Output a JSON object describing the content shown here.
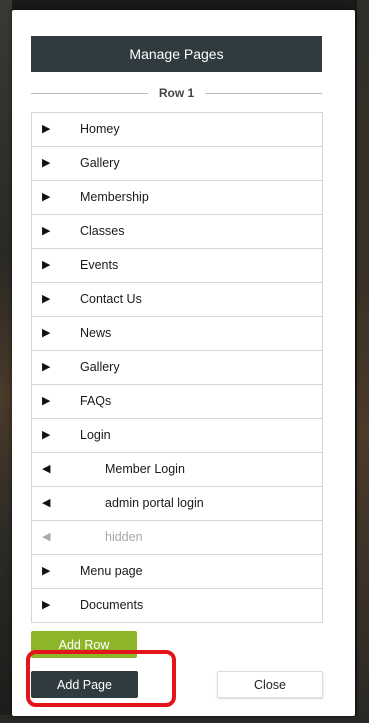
{
  "modal": {
    "title": "Manage Pages",
    "row_label": "Row 1",
    "pages": [
      {
        "label": "Homey",
        "arrow": "▶",
        "level": "top",
        "state": "normal"
      },
      {
        "label": "Gallery",
        "arrow": "▶",
        "level": "top",
        "state": "normal"
      },
      {
        "label": "Membership",
        "arrow": "▶",
        "level": "top",
        "state": "normal"
      },
      {
        "label": "Classes",
        "arrow": "▶",
        "level": "top",
        "state": "normal"
      },
      {
        "label": "Events",
        "arrow": "▶",
        "level": "top",
        "state": "normal"
      },
      {
        "label": "Contact Us",
        "arrow": "▶",
        "level": "top",
        "state": "normal"
      },
      {
        "label": "News",
        "arrow": "▶",
        "level": "top",
        "state": "normal"
      },
      {
        "label": "Gallery",
        "arrow": "▶",
        "level": "top",
        "state": "normal"
      },
      {
        "label": "FAQs",
        "arrow": "▶",
        "level": "top",
        "state": "normal"
      },
      {
        "label": "Login",
        "arrow": "▶",
        "level": "top",
        "state": "normal"
      },
      {
        "label": "Member Login",
        "arrow": "◀",
        "level": "sub",
        "state": "normal"
      },
      {
        "label": "admin portal login",
        "arrow": "◀",
        "level": "sub",
        "state": "normal"
      },
      {
        "label": "hidden",
        "arrow": "◀",
        "level": "sub",
        "state": "hidden"
      },
      {
        "label": "Menu page",
        "arrow": "▶",
        "level": "top",
        "state": "normal"
      },
      {
        "label": "Documents",
        "arrow": "▶",
        "level": "top",
        "state": "normal"
      }
    ],
    "add_row_label": "Add Row",
    "add_page_label": "Add Page",
    "close_label": "Close"
  },
  "colors": {
    "header_bg": "#2f3b3e",
    "add_row_bg": "#8db52a",
    "add_page_bg": "#2f3b3e",
    "highlight": "#e3151a",
    "hidden_text": "#a8a8a8"
  }
}
